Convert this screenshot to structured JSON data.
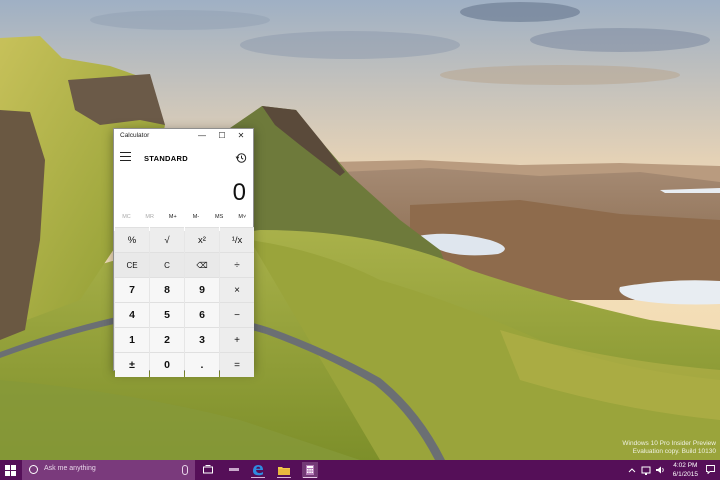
{
  "desktop": {
    "watermark_line1": "Windows 10 Pro Insider Preview",
    "watermark_line2": "Evaluation copy. Build 10130"
  },
  "calculator": {
    "window_title": "Calculator",
    "window_buttons": {
      "minimize": "—",
      "maximize": "☐",
      "close": "✕"
    },
    "mode": "STANDARD",
    "display_value": "0",
    "memory_buttons": [
      {
        "label": "MC",
        "enabled": false
      },
      {
        "label": "MR",
        "enabled": false
      },
      {
        "label": "M+",
        "enabled": true
      },
      {
        "label": "M-",
        "enabled": true
      },
      {
        "label": "MS",
        "enabled": true
      },
      {
        "label": "M˅",
        "enabled": true
      }
    ],
    "keys": [
      {
        "label": "%",
        "kind": "top",
        "name": "percent-key"
      },
      {
        "label": "√",
        "kind": "top",
        "name": "sqrt-key"
      },
      {
        "label": "x²",
        "kind": "top",
        "name": "square-key"
      },
      {
        "label": "¹/x",
        "kind": "top",
        "name": "reciprocal-key"
      },
      {
        "label": "CE",
        "kind": "fn",
        "name": "clear-entry-key"
      },
      {
        "label": "C",
        "kind": "fn",
        "name": "clear-key"
      },
      {
        "label": "⌫",
        "kind": "fn",
        "name": "backspace-key"
      },
      {
        "label": "÷",
        "kind": "op",
        "name": "divide-key"
      },
      {
        "label": "7",
        "kind": "num",
        "name": "digit-7-key"
      },
      {
        "label": "8",
        "kind": "num",
        "name": "digit-8-key"
      },
      {
        "label": "9",
        "kind": "num",
        "name": "digit-9-key"
      },
      {
        "label": "×",
        "kind": "op",
        "name": "multiply-key"
      },
      {
        "label": "4",
        "kind": "num",
        "name": "digit-4-key"
      },
      {
        "label": "5",
        "kind": "num",
        "name": "digit-5-key"
      },
      {
        "label": "6",
        "kind": "num",
        "name": "digit-6-key"
      },
      {
        "label": "−",
        "kind": "op",
        "name": "subtract-key"
      },
      {
        "label": "1",
        "kind": "num",
        "name": "digit-1-key"
      },
      {
        "label": "2",
        "kind": "num",
        "name": "digit-2-key"
      },
      {
        "label": "3",
        "kind": "num",
        "name": "digit-3-key"
      },
      {
        "label": "+",
        "kind": "op",
        "name": "add-key"
      },
      {
        "label": "±",
        "kind": "num",
        "name": "negate-key"
      },
      {
        "label": "0",
        "kind": "num",
        "name": "digit-0-key"
      },
      {
        "label": ".",
        "kind": "num",
        "name": "decimal-key"
      },
      {
        "label": "=",
        "kind": "op",
        "name": "equals-key"
      }
    ]
  },
  "taskbar": {
    "search_placeholder": "Ask me anything",
    "clock_time": "4:02 PM",
    "clock_date": "6/1/2015",
    "accent_color": "#550f58"
  }
}
